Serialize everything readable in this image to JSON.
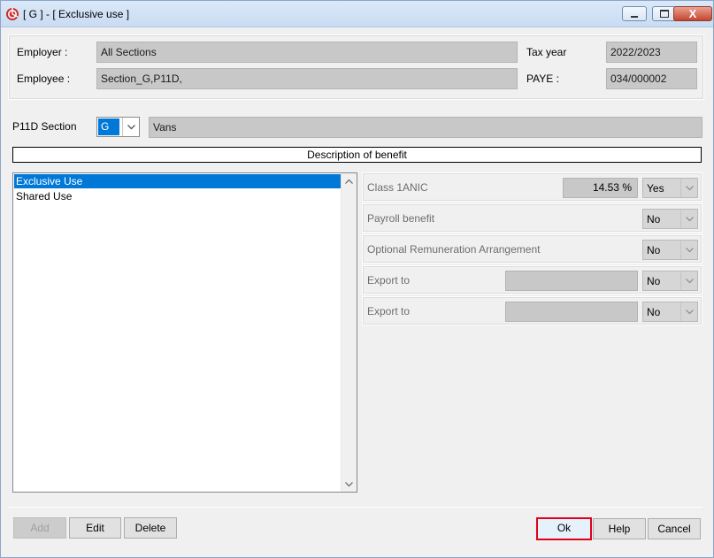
{
  "window": {
    "title": "[ G ] - [ Exclusive use ]",
    "controls": {
      "minimize": "minimize",
      "maximize": "maximize",
      "close": "X"
    }
  },
  "header": {
    "employer_label": "Employer :",
    "employer_value": "All Sections",
    "employee_label": "Employee :",
    "employee_value": "Section_G,P11D,",
    "taxyear_label": "Tax year",
    "taxyear_value": "2022/2023",
    "paye_label": "PAYE :",
    "paye_value": "034/000002"
  },
  "section": {
    "label": "P11D Section",
    "code": "G",
    "name": "Vans"
  },
  "description_header": "Description of benefit",
  "benefits": [
    {
      "label": "Exclusive Use",
      "selected": true
    },
    {
      "label": "Shared Use",
      "selected": false
    }
  ],
  "properties": {
    "class1a": {
      "label": "Class 1ANIC",
      "percent": "14.53 %",
      "value": "Yes"
    },
    "payroll": {
      "label": "Payroll benefit",
      "value": "No"
    },
    "ora": {
      "label": "Optional Remuneration Arrangement",
      "value": "No"
    },
    "export1": {
      "label": "Export to",
      "value": "No"
    },
    "export2": {
      "label": "Export to",
      "value": "No"
    }
  },
  "buttons": {
    "add": "Add",
    "edit": "Edit",
    "delete": "Delete",
    "ok": "Ok",
    "help": "Help",
    "cancel": "Cancel"
  },
  "colors": {
    "selection": "#0078d7",
    "highlight_border": "#e0001a"
  }
}
